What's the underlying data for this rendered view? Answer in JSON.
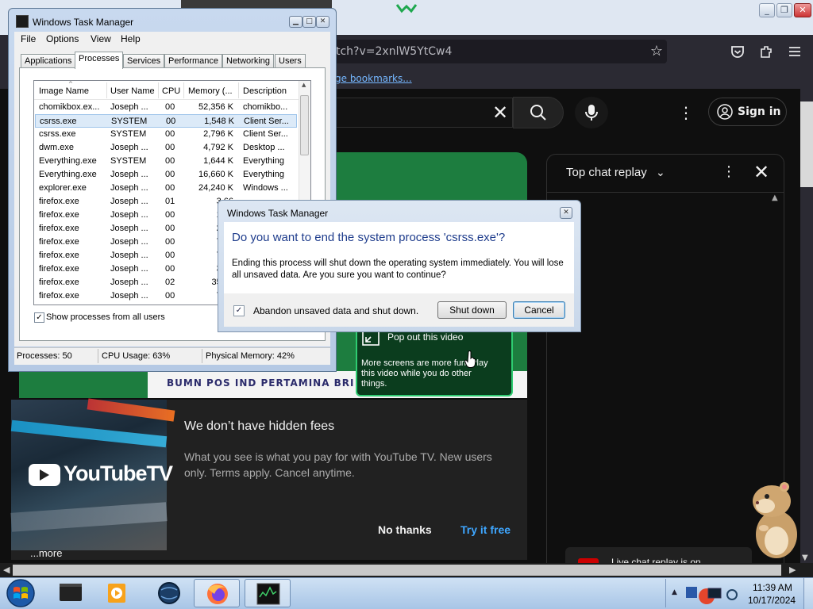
{
  "browser": {
    "url_text": "tch?v=2xnlW5YtCw4",
    "bookmarks_link": "ge bookmarks..."
  },
  "youtube": {
    "sign_in": "Sign in",
    "popout": {
      "title": "Pop out this video",
      "desc": "More screens are more fun. Play this video while you do other things."
    },
    "banner_text": "BUMN   POS IND   PERTAMINA   BRI",
    "chat": {
      "title": "Top chat replay",
      "footer": "Live chat replay is on"
    },
    "ad": {
      "logo_text": "YouTubeTV",
      "title": "We don’t have hidden fees",
      "desc": "What you see is what you pay for with YouTube TV. New users only. Terms apply. Cancel anytime.",
      "no_thanks": "No thanks",
      "try_free": "Try it free"
    },
    "more": "...more"
  },
  "task_manager": {
    "title": "Windows Task Manager",
    "menu": [
      "File",
      "Options",
      "View",
      "Help"
    ],
    "tabs": [
      "Applications",
      "Processes",
      "Services",
      "Performance",
      "Networking",
      "Users"
    ],
    "active_tab": "Processes",
    "columns": [
      "Image Name",
      "User Name",
      "CPU",
      "Memory (...",
      "Description"
    ],
    "rows": [
      [
        "chomikbox.ex...",
        "Joseph ...",
        "00",
        "52,356 K",
        "chomikbo..."
      ],
      [
        "csrss.exe",
        "SYSTEM",
        "00",
        "1,548 K",
        "Client Ser..."
      ],
      [
        "csrss.exe",
        "SYSTEM",
        "00",
        "2,796 K",
        "Client Ser..."
      ],
      [
        "dwm.exe",
        "Joseph ...",
        "00",
        "4,792 K",
        "Desktop ..."
      ],
      [
        "Everything.exe",
        "SYSTEM",
        "00",
        "1,644 K",
        "Everything"
      ],
      [
        "Everything.exe",
        "Joseph ...",
        "00",
        "16,660 K",
        "Everything"
      ],
      [
        "explorer.exe",
        "Joseph ...",
        "00",
        "24,240 K",
        "Windows ..."
      ],
      [
        "firefox.exe",
        "Joseph ...",
        "01",
        "3,66",
        ""
      ],
      [
        "firefox.exe",
        "Joseph ...",
        "00",
        "12,8",
        ""
      ],
      [
        "firefox.exe",
        "Joseph ...",
        "00",
        "25,2",
        ""
      ],
      [
        "firefox.exe",
        "Joseph ...",
        "00",
        "7,54",
        ""
      ],
      [
        "firefox.exe",
        "Joseph ...",
        "00",
        "7,60",
        ""
      ],
      [
        "firefox.exe",
        "Joseph ...",
        "00",
        "3,70",
        ""
      ],
      [
        "firefox.exe",
        "Joseph ...",
        "02",
        "35,37",
        ""
      ],
      [
        "firefox.exe",
        "Joseph ...",
        "00",
        "7,60",
        ""
      ]
    ],
    "selected_row": 1,
    "show_all_label": "Show processes from all users",
    "status": {
      "processes": "Processes: 50",
      "cpu": "CPU Usage: 63%",
      "memory": "Physical Memory: 42%"
    }
  },
  "dialog": {
    "title": "Windows Task Manager",
    "heading": "Do you want to end the system process 'csrss.exe'?",
    "text": "Ending this process will shut down the operating system immediately.  You will lose all unsaved data.  Are you sure you want to continue?",
    "checkbox_label": "Abandon unsaved data and shut down.",
    "checkbox_checked": true,
    "shutdown_label": "Shut down",
    "cancel_label": "Cancel"
  },
  "taskbar": {
    "time": "11:39 AM",
    "date": "10/17/2024"
  },
  "colors": {
    "dialog_heading": "#1e3c8c",
    "yt_link": "#3ea6ff",
    "video_green": "#1d7d3f"
  }
}
